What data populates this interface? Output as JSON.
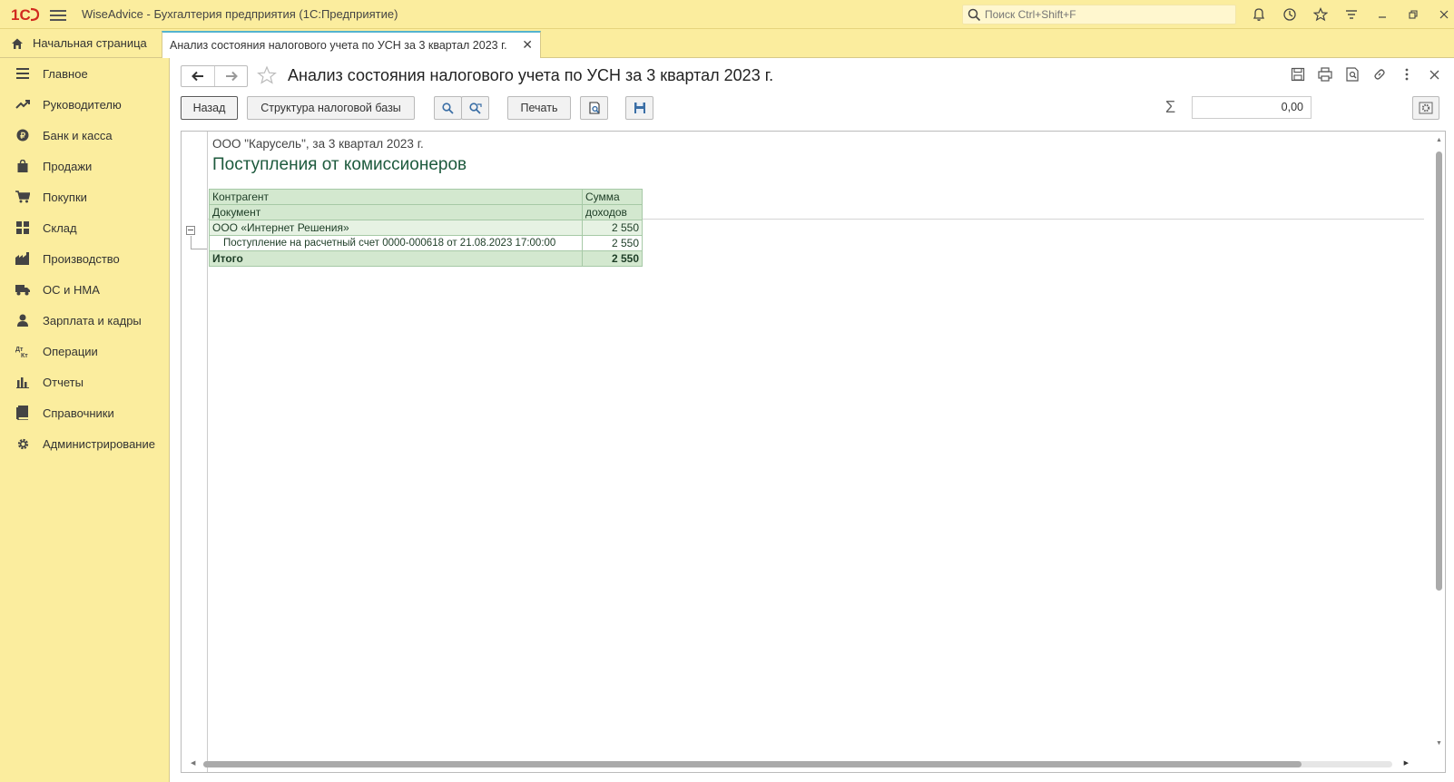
{
  "window": {
    "title": "WiseAdvice - Бухгалтерия предприятия  (1С:Предприятие)",
    "search_placeholder": "Поиск Ctrl+Shift+F"
  },
  "tabs": {
    "home": "Начальная страница",
    "active": "Анализ состояния налогового учета по УСН за 3 квартал 2023 г."
  },
  "sidebar": {
    "items": [
      {
        "label": "Главное",
        "icon": "menu-icon"
      },
      {
        "label": "Руководителю",
        "icon": "trend-icon"
      },
      {
        "label": "Банк и касса",
        "icon": "coin-icon"
      },
      {
        "label": "Продажи",
        "icon": "bag-icon"
      },
      {
        "label": "Покупки",
        "icon": "cart-icon"
      },
      {
        "label": "Склад",
        "icon": "warehouse-icon"
      },
      {
        "label": "Производство",
        "icon": "factory-icon"
      },
      {
        "label": "ОС и НМА",
        "icon": "truck-icon"
      },
      {
        "label": "Зарплата и кадры",
        "icon": "person-icon"
      },
      {
        "label": "Операции",
        "icon": "operations-icon"
      },
      {
        "label": "Отчеты",
        "icon": "bar-chart-icon"
      },
      {
        "label": "Справочники",
        "icon": "book-icon"
      },
      {
        "label": "Администрирование",
        "icon": "gear-icon"
      }
    ]
  },
  "document": {
    "title": "Анализ состояния налогового учета по УСН за 3 квартал 2023 г.",
    "buttons": {
      "back": "Назад",
      "structure": "Структура налоговой базы",
      "print": "Печать"
    },
    "sum_value": "0,00"
  },
  "report": {
    "org_line": "ООО \"Карусель\",  за 3 квартал 2023 г.",
    "title": "Поступления от комиссионеров",
    "columns": {
      "col1_line1": "Контрагент",
      "col1_line2": "Документ",
      "col2_line1": "Сумма",
      "col2_line2": "доходов"
    },
    "group": {
      "name": "ООО «Интернет Решения»",
      "amount": "2 550"
    },
    "detail": {
      "name": "Поступление на расчетный счет 0000-000618 от 21.08.2023 17:00:00",
      "amount": "2 550"
    },
    "total": {
      "label": "Итого",
      "amount": "2 550"
    }
  },
  "colors": {
    "sidebar_bg": "#fbed9e",
    "tab_accent": "#54b3cf",
    "report_title": "#1d5a3d",
    "table_header": "#d3e8cf"
  }
}
